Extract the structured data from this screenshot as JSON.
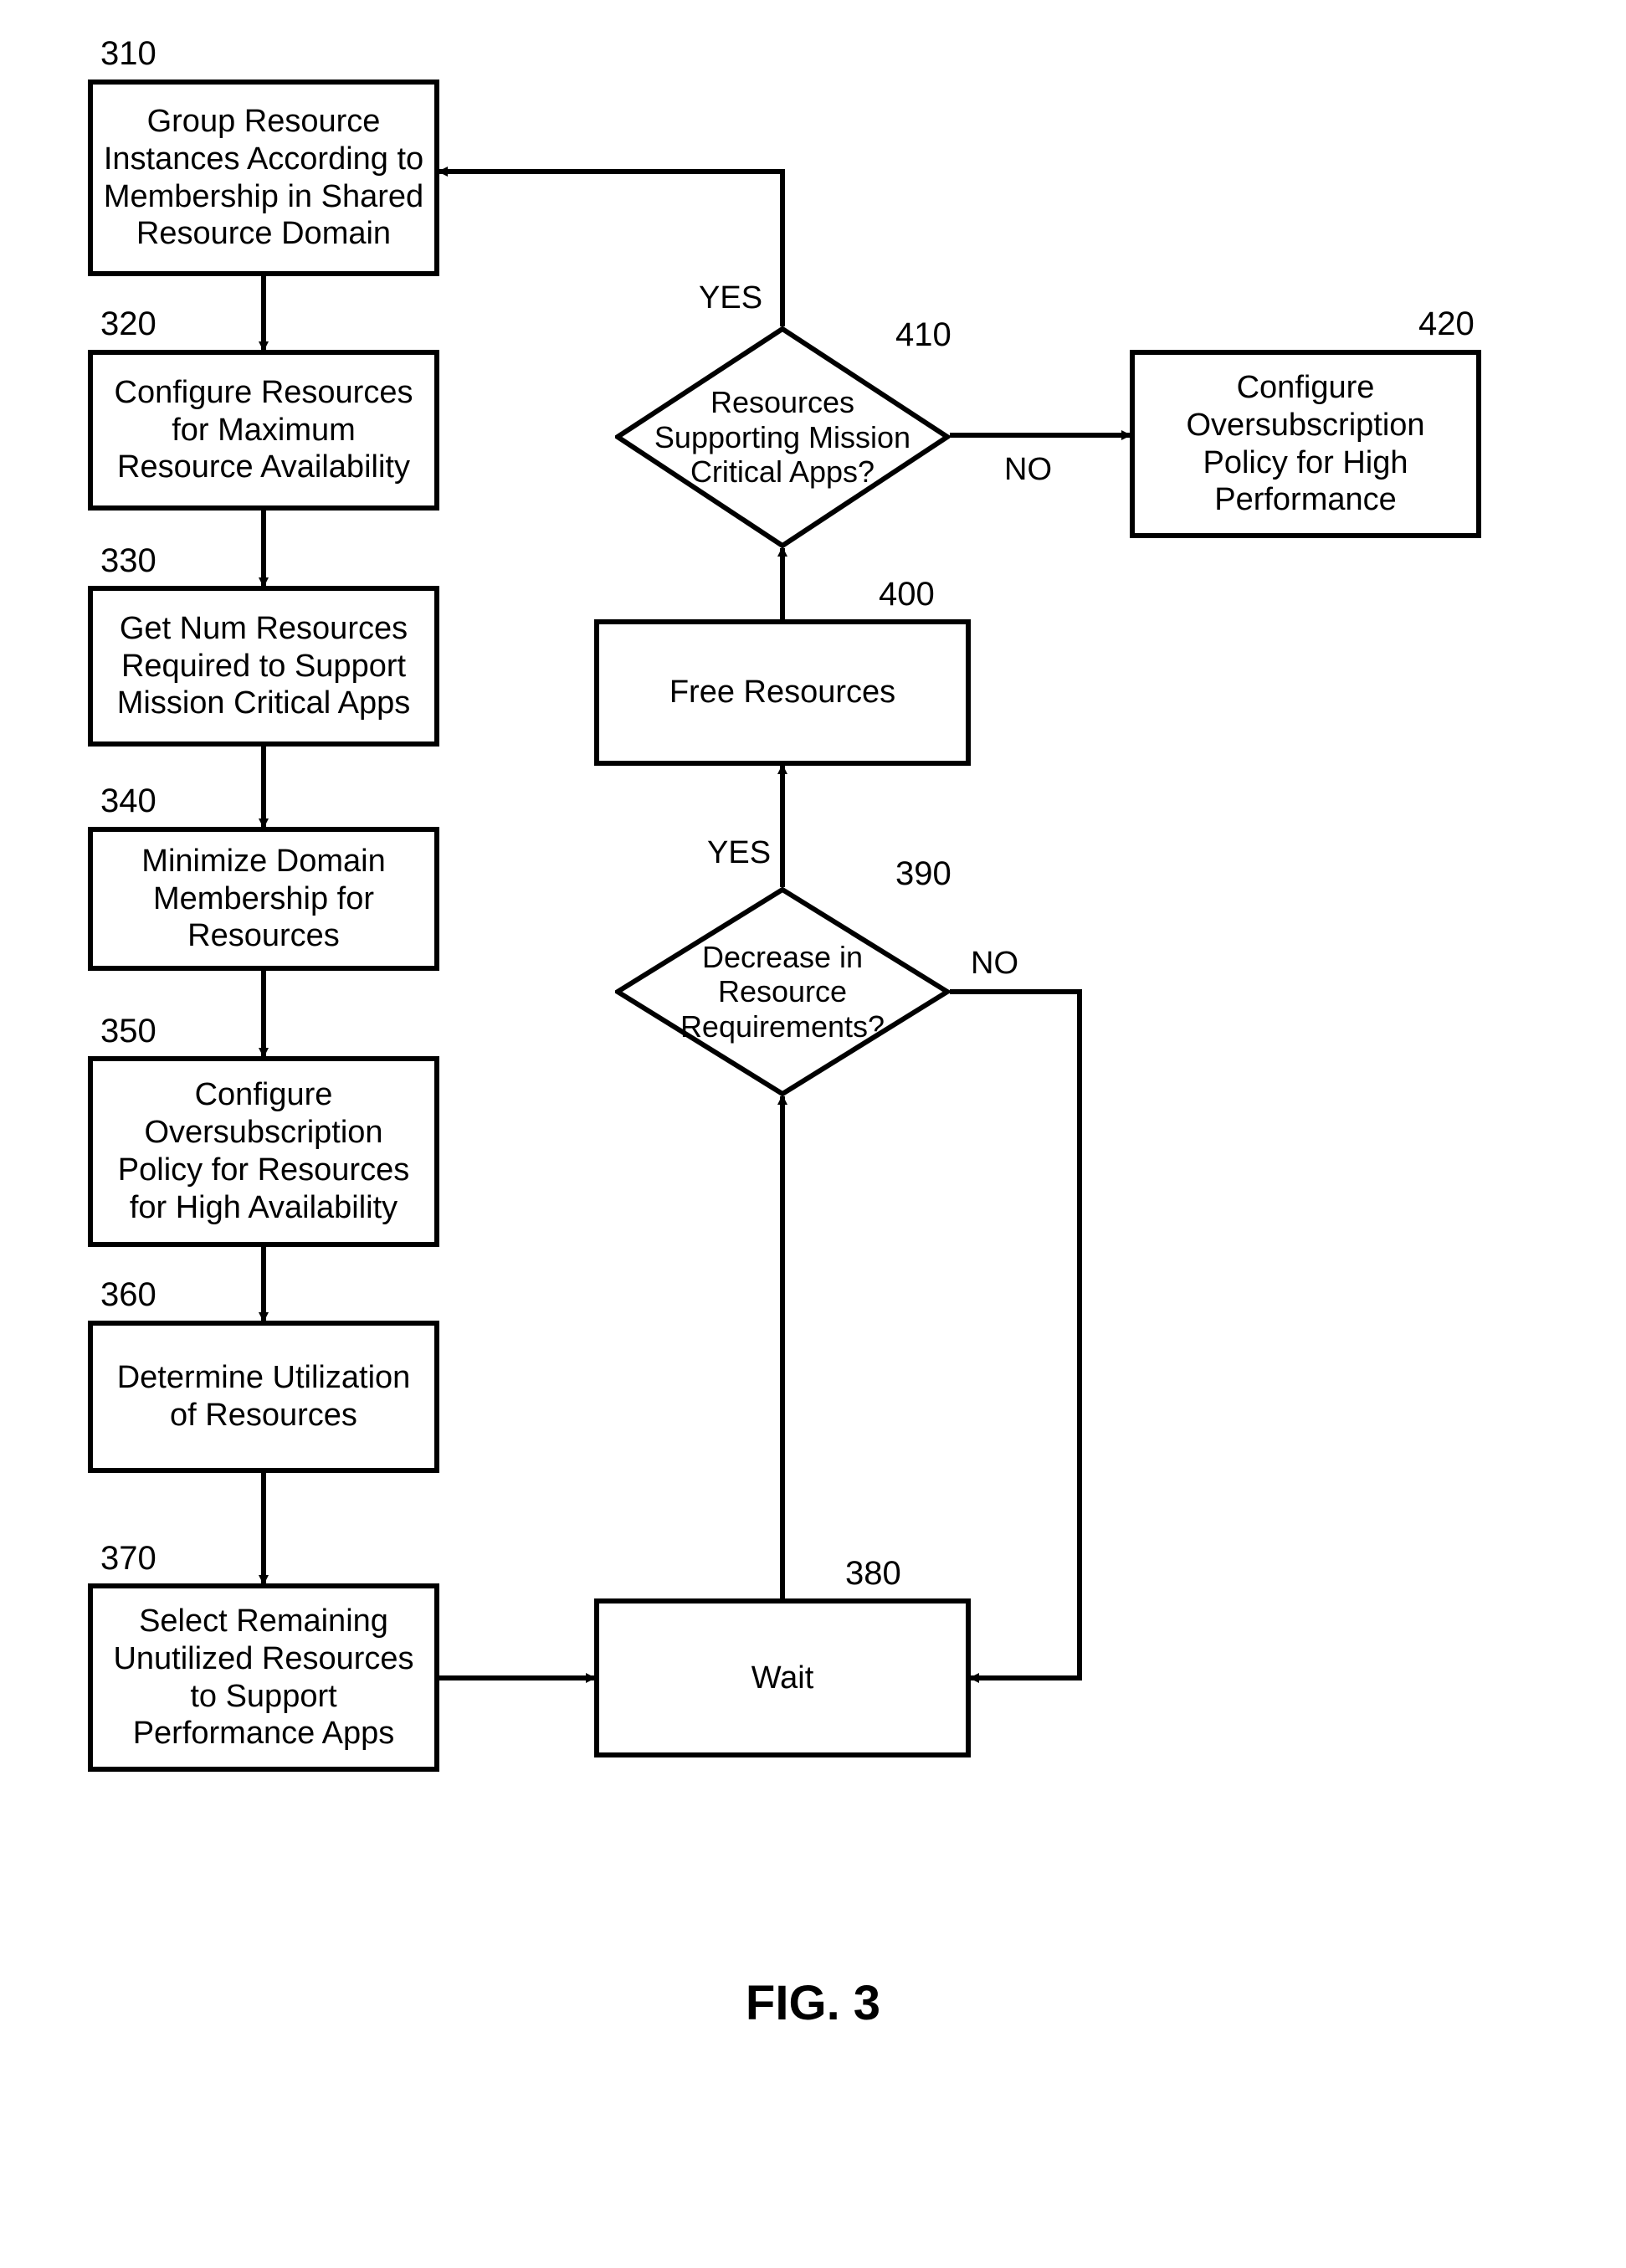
{
  "figure_caption": "FIG. 3",
  "nodes": {
    "n310": {
      "num": "310",
      "text": "Group Resource Instances According to Membership in Shared Resource Domain"
    },
    "n320": {
      "num": "320",
      "text": "Configure Resources for Maximum Resource Availability"
    },
    "n330": {
      "num": "330",
      "text": "Get Num Resources Required to Support Mission Critical Apps"
    },
    "n340": {
      "num": "340",
      "text": "Minimize Domain Membership for Resources"
    },
    "n350": {
      "num": "350",
      "text": "Configure Oversubscription Policy for Resources for High Availability"
    },
    "n360": {
      "num": "360",
      "text": "Determine Utilization of Resources"
    },
    "n370": {
      "num": "370",
      "text": "Select Remaining Unutilized Resources to Support Performance Apps"
    },
    "n380": {
      "num": "380",
      "text": "Wait"
    },
    "n390": {
      "num": "390",
      "text": "Decrease in Resource Requirements?"
    },
    "n400": {
      "num": "400",
      "text": "Free Resources"
    },
    "n410": {
      "num": "410",
      "text": "Resources Supporting Mission Critical Apps?"
    },
    "n420": {
      "num": "420",
      "text": "Configure Oversubscription Policy for High Performance"
    }
  },
  "edge_labels": {
    "yes1": "YES",
    "no1": "NO",
    "yes2": "YES",
    "no2": "NO"
  }
}
